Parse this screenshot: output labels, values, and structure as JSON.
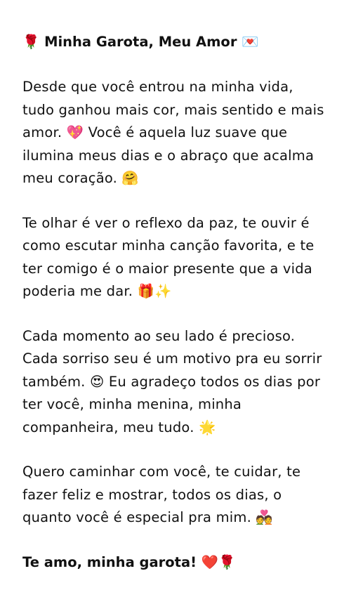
{
  "title": "🌹 Minha Garota, Meu Amor 💌",
  "paragraphs": [
    "Desde que você entrou na minha vida, tudo ganhou mais cor, mais sentido e mais amor. 💖 Você é aquela luz suave que ilumina meus dias e o abraço que acalma meu coração. 🤗",
    "Te olhar é ver o reflexo da paz, te ouvir é como escutar minha canção favorita, e te ter comigo é o maior presente que a vida poderia me dar. 🎁✨",
    "Cada momento ao seu lado é precioso. Cada sorriso seu é um motivo pra eu sorrir também. 😍 Eu agradeço todos os dias por ter você, minha menina, minha companheira, meu tudo. 🌟",
    "Quero caminhar com você, te cuidar, te fazer feliz e mostrar, todos os dias, o quanto você é especial pra mim. 💑"
  ],
  "closing": "Te amo, minha garota! ❤️🌹"
}
